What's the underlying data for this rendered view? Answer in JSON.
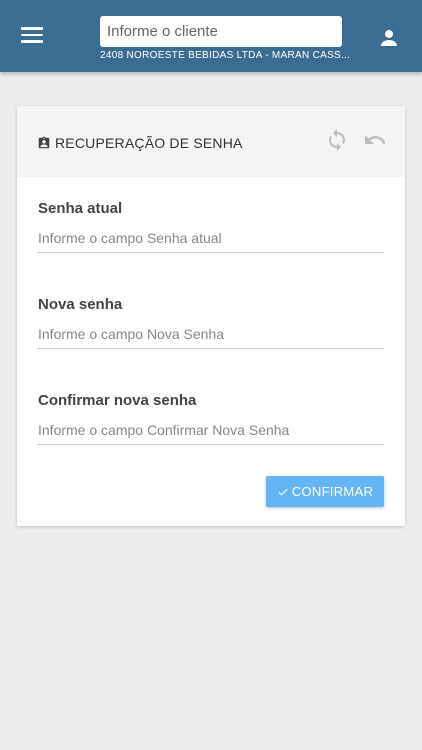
{
  "topbar": {
    "menu_icon": "hamburger-menu-icon",
    "client_search": {
      "placeholder": "Informe o cliente",
      "value": ""
    },
    "client_caption": "2408 NOROESTE BEBIDAS LTDA - MARAN CASS...",
    "user_icon": "account-icon",
    "color": "#3a6d93"
  },
  "card": {
    "title": "RECUPERAÇÃO DE SENHA",
    "title_icon": "id-badge-icon",
    "refresh_icon": "refresh-icon",
    "undo_icon": "undo-icon",
    "fields": [
      {
        "label": "Senha atual",
        "placeholder": "Informe o campo Senha atual",
        "value": ""
      },
      {
        "label": "Nova senha",
        "placeholder": "Informe o campo Nova Senha",
        "value": ""
      },
      {
        "label": "Confirmar nova senha",
        "placeholder": "Informe o campo Confirmar Nova Senha",
        "value": ""
      }
    ],
    "confirm_label": "CONFIRMAR",
    "confirm_icon": "check-icon",
    "confirm_color": "#64b5f6"
  }
}
